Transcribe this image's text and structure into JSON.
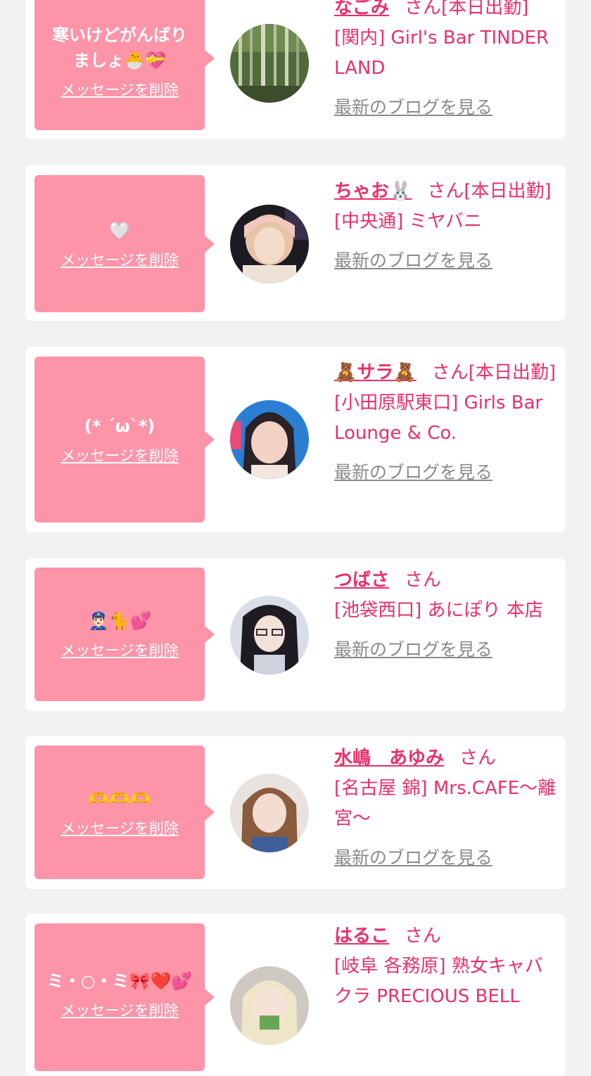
{
  "delete_label": "メッセージを削除",
  "blog_label": "最新のブログを見る",
  "san_label": "さん",
  "colors": {
    "background": "#f2f2f2",
    "card": "#ffffff",
    "bubble": "#fd94a8",
    "accent": "#e8306b",
    "link_gray": "#8a8a8a"
  },
  "items": [
    {
      "message": "寒いけどがんばり\nましょ🐣💝",
      "name": "なごみ",
      "status": "[本日出勤]",
      "shop": "[関内] Girl's Bar TINDER LAND",
      "avatar_icon": "bamboo-forest-photo"
    },
    {
      "message": "🤍",
      "name": "ちゃお🐰",
      "status": "[本日出勤]",
      "shop": "[中央通] ミヤバニ",
      "avatar_icon": "girl-portrait-photo"
    },
    {
      "message": "(* ´ω`*)",
      "name": "🧸サラ🧸",
      "status": "[本日出勤]",
      "shop": "[小田原駅東口] Girls Bar Lounge & Co.",
      "avatar_icon": "girl-portrait-photo"
    },
    {
      "message": "👮🏻‍♂️🐈💕",
      "name": "つばさ",
      "status": "",
      "shop": "[池袋西口] あにぽり 本店",
      "avatar_icon": "girl-portrait-photo"
    },
    {
      "message": "🫶🫶🫶",
      "name": "水嶋　あゆみ",
      "status": "",
      "shop": "[名古屋 錦] Mrs.CAFE〜離宮〜",
      "avatar_icon": "girl-portrait-photo"
    },
    {
      "message": "ミ・○・ミ🎀❤️💕",
      "name": "はるこ",
      "status": "",
      "shop": "[岐阜 各務原]  熟女キャバクラ PRECIOUS BELL",
      "avatar_icon": "girl-portrait-photo"
    }
  ]
}
